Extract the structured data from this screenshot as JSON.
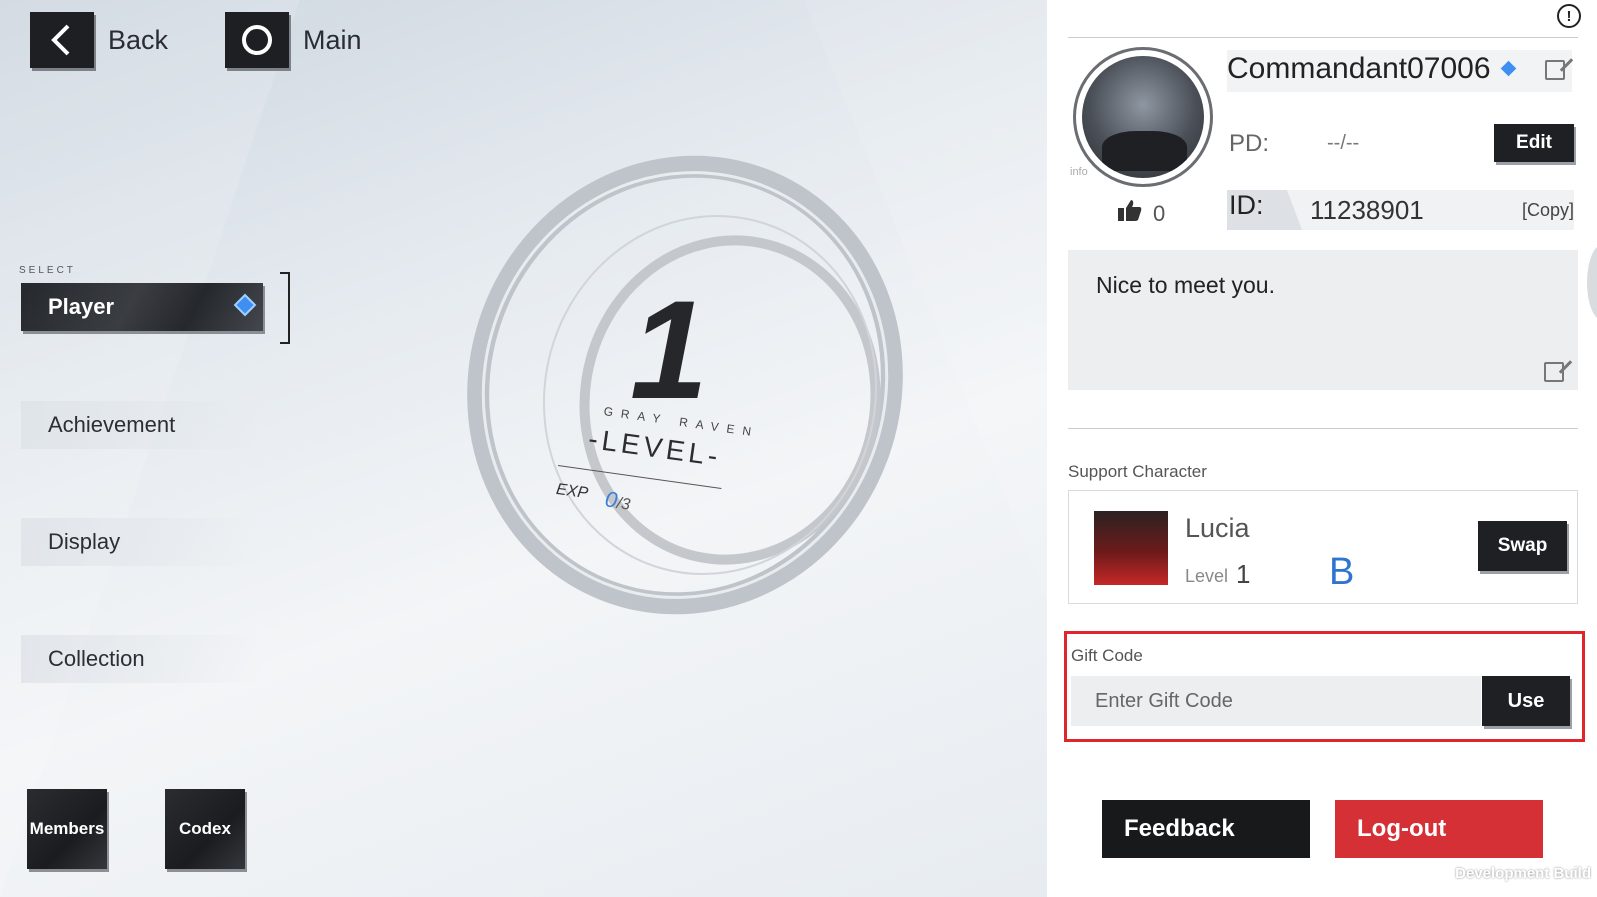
{
  "nav": {
    "back_label": "Back",
    "main_label": "Main"
  },
  "menu": {
    "select_tag": "SELECT",
    "items": [
      {
        "label": "Player"
      },
      {
        "label": "Achievement"
      },
      {
        "label": "Display"
      },
      {
        "label": "Collection"
      }
    ]
  },
  "tiles": {
    "members": "Members",
    "codex": "Codex"
  },
  "level": {
    "value": "1",
    "subtitle": "GRAY RAVEN",
    "label": "-LEVEL-",
    "exp_label": "EXP",
    "exp_current": "0",
    "exp_max": "/3"
  },
  "profile": {
    "info_tag": "info",
    "likes": "0",
    "name": "Commandant07006",
    "pd_label": "PD:",
    "pd_value": "--/--",
    "edit_label": "Edit",
    "id_label": "ID:",
    "id_value": "11238901",
    "copy_label": "[Copy]",
    "message": "Nice to meet you."
  },
  "support": {
    "title": "Support Character",
    "char_name": "Lucia",
    "level_label": "Level",
    "level_value": "1",
    "rank": "B",
    "swap_label": "Swap"
  },
  "gift": {
    "title": "Gift Code",
    "placeholder": "Enter Gift Code",
    "use_label": "Use"
  },
  "footer": {
    "feedback_label": "Feedback",
    "logout_label": "Log-out",
    "dev_build": "Development Build"
  },
  "colors": {
    "accent_blue": "#3f8ef2",
    "logout_red": "#d53035",
    "highlight_red": "#e0262b"
  },
  "icons": {
    "back": "chevron-left-icon",
    "main": "circle-icon",
    "info": "exclamation-circle-icon",
    "likes": "thumbs-up-icon",
    "edit": "edit-icon"
  }
}
